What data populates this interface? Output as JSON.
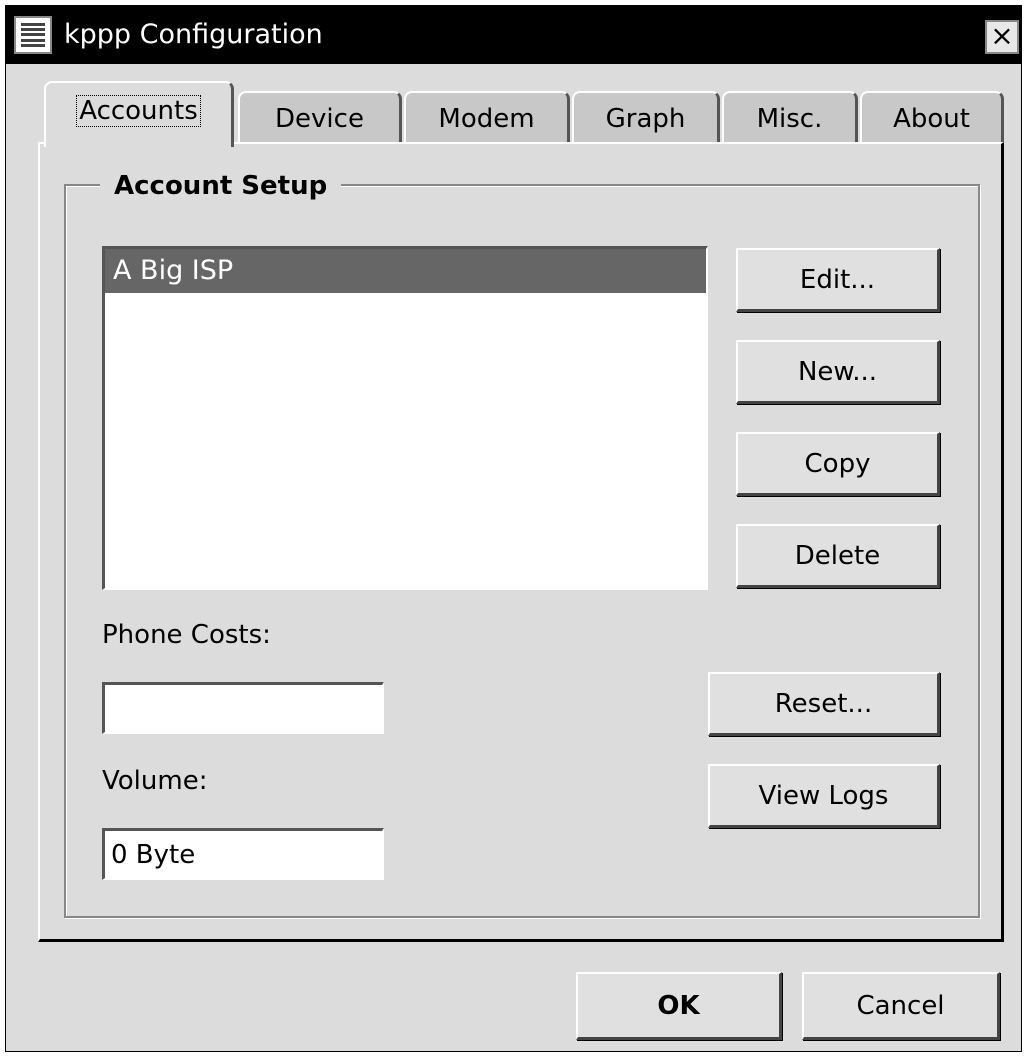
{
  "window": {
    "title": "kppp Configuration",
    "close_glyph": "×"
  },
  "tabs": [
    {
      "label": "Accounts",
      "active": true
    },
    {
      "label": "Device",
      "active": false
    },
    {
      "label": "Modem",
      "active": false
    },
    {
      "label": "Graph",
      "active": false
    },
    {
      "label": "Misc.",
      "active": false
    },
    {
      "label": "About",
      "active": false
    }
  ],
  "account_setup": {
    "title": "Account Setup",
    "accounts": [
      {
        "name": "A Big ISP",
        "selected": true
      }
    ],
    "buttons": {
      "edit": "Edit...",
      "new": "New...",
      "copy": "Copy",
      "delete": "Delete",
      "reset": "Reset...",
      "view_logs": "View Logs"
    },
    "phone_costs_label": "Phone Costs:",
    "phone_costs_value": "",
    "volume_label": "Volume:",
    "volume_value": "0 Byte"
  },
  "footer": {
    "ok": "OK",
    "cancel": "Cancel"
  },
  "colors": {
    "titlebar": "#000000",
    "face": "#dcdcdc",
    "selection": "#666666"
  },
  "icons": {
    "window_menu": "window-menu-icon",
    "close": "close-icon"
  }
}
